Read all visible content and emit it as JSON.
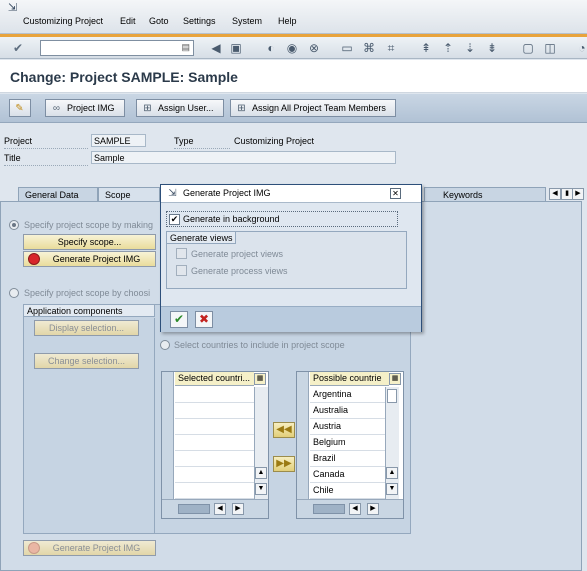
{
  "menu": {
    "items": [
      {
        "label": "Customizing Project"
      },
      {
        "label": "Edit"
      },
      {
        "label": "Goto"
      },
      {
        "label": "Settings"
      },
      {
        "label": "System"
      },
      {
        "label": "Help"
      }
    ]
  },
  "page_title": "Change: Project SAMPLE: Sample",
  "app_toolbar": {
    "project_img": "Project IMG",
    "assign_user": "Assign User...",
    "assign_all": "Assign All Project Team Members"
  },
  "header": {
    "project_label": "Project",
    "project_value": "SAMPLE",
    "type_label": "Type",
    "type_value": "Customizing Project",
    "title_label": "Title",
    "title_value": "Sample"
  },
  "tabs": {
    "general_data": "General Data",
    "scope": "Scope",
    "keywords": "Keywords"
  },
  "scope": {
    "option1": "Specify project scope by making",
    "specify_scope_btn": "Specify scope...",
    "generate_img_btn": "Generate Project IMG",
    "option2": "Specify project scope by choosi",
    "app_components_header": "Application components",
    "display_selection_btn": "Display selection...",
    "change_selection_btn": "Change selection...",
    "countries_option": "Select countries to include in project scope",
    "selected_countries_header": "Selected countri...",
    "possible_countries_header": "Possible countrie",
    "possible_countries": [
      "Argentina",
      "Australia",
      "Austria",
      "Belgium",
      "Brazil",
      "Canada",
      "Chile"
    ],
    "bottom_generate_btn": "Generate Project IMG"
  },
  "dialog": {
    "title": "Generate Project IMG",
    "generate_background": "Generate in background",
    "generate_views_header": "Generate views",
    "generate_project_views": "Generate project views",
    "generate_process_views": "Generate process views"
  }
}
